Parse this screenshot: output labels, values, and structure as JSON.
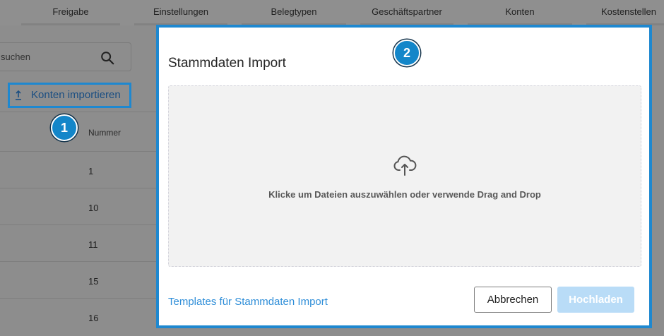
{
  "nav": {
    "tabs": [
      {
        "label": "Freigabe"
      },
      {
        "label": "Einstellungen"
      },
      {
        "label": "Belegtypen"
      },
      {
        "label": "Geschäftspartner"
      },
      {
        "label": "Konten"
      },
      {
        "label": "Kostenstellen"
      }
    ]
  },
  "search": {
    "placeholder_text": "suchen",
    "icon": "search-icon"
  },
  "import_button": {
    "label": "Konten importieren",
    "icon": "upload-arrow-icon",
    "callout": "1"
  },
  "table": {
    "column_header": "Nummer",
    "rows": [
      "1",
      "10",
      "11",
      "15",
      "16"
    ]
  },
  "modal": {
    "title": "Stammdaten Import",
    "callout": "2",
    "dropzone": {
      "icon": "cloud-upload-icon",
      "text": "Klicke um Dateien auszuwählen oder verwende Drag and Drop"
    },
    "templates_link": "Templates für Stammdaten Import",
    "cancel_label": "Abbrechen",
    "upload_label": "Hochladen"
  },
  "colors": {
    "accent": "#1e88d0",
    "badge": "#1386c9",
    "link": "#2f8ed8",
    "upload_disabled": "#b9dcf7",
    "overlay": "#8d8d8d"
  }
}
